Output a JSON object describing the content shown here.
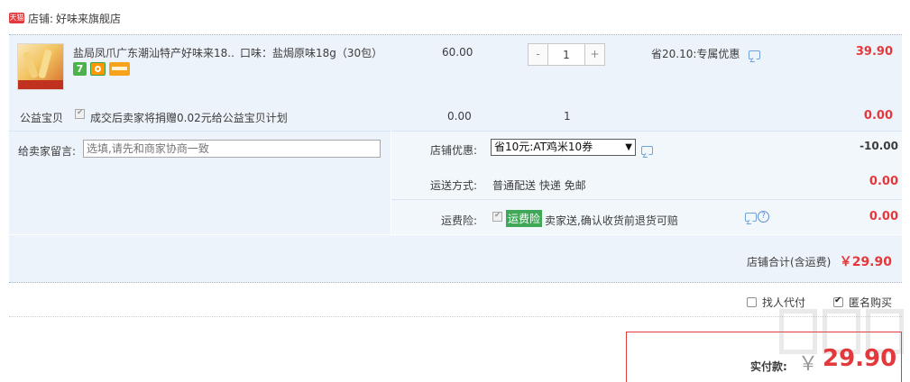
{
  "shop": {
    "logo_text": "天猫",
    "label": "店铺:",
    "name": "好味来旗舰店"
  },
  "item": {
    "title": "盐局凤爪广东潮汕特产好味来18...",
    "sku": "口味：盐焗原味18g（30包）",
    "badges": [
      "7",
      "shield-badge",
      "card-badge"
    ],
    "badge_7": "7",
    "price": "60.00",
    "quantity": "1",
    "minus": "-",
    "plus": "+",
    "promo": "省20.10:专属优惠",
    "subtotal": "39.90"
  },
  "charity": {
    "label": "公益宝贝",
    "text": "成交后卖家将捐赠0.02元给公益宝贝计划",
    "amount": "0.00",
    "quantity": "1",
    "total": "0.00"
  },
  "message": {
    "label": "给卖家留言:",
    "placeholder": "选填,请先和商家协商一致"
  },
  "coupon": {
    "label": "店铺优惠:",
    "selected": "省10元:AT鸡米10券",
    "amount": "-10.00"
  },
  "shipping": {
    "label": "运送方式:",
    "value": "普通配送 快递 免邮",
    "amount": "0.00"
  },
  "insurance": {
    "label": "运费险:",
    "tag": "运费险",
    "text": "卖家送,确认收货前退货可赔",
    "help": "?",
    "amount": "0.00"
  },
  "store_total": {
    "label": "店铺合计(含运费)",
    "value": "￥29.90"
  },
  "options": {
    "proxy_pay": "找人代付",
    "anonymous": "匿名购买",
    "anonymous_checked": true
  },
  "payment": {
    "label": "实付款:",
    "currency": "￥",
    "amount": "29.90"
  },
  "colors": {
    "accent_red": "#e4393c",
    "row_bg": "#edf3fb",
    "tag_green": "#3ea856"
  }
}
